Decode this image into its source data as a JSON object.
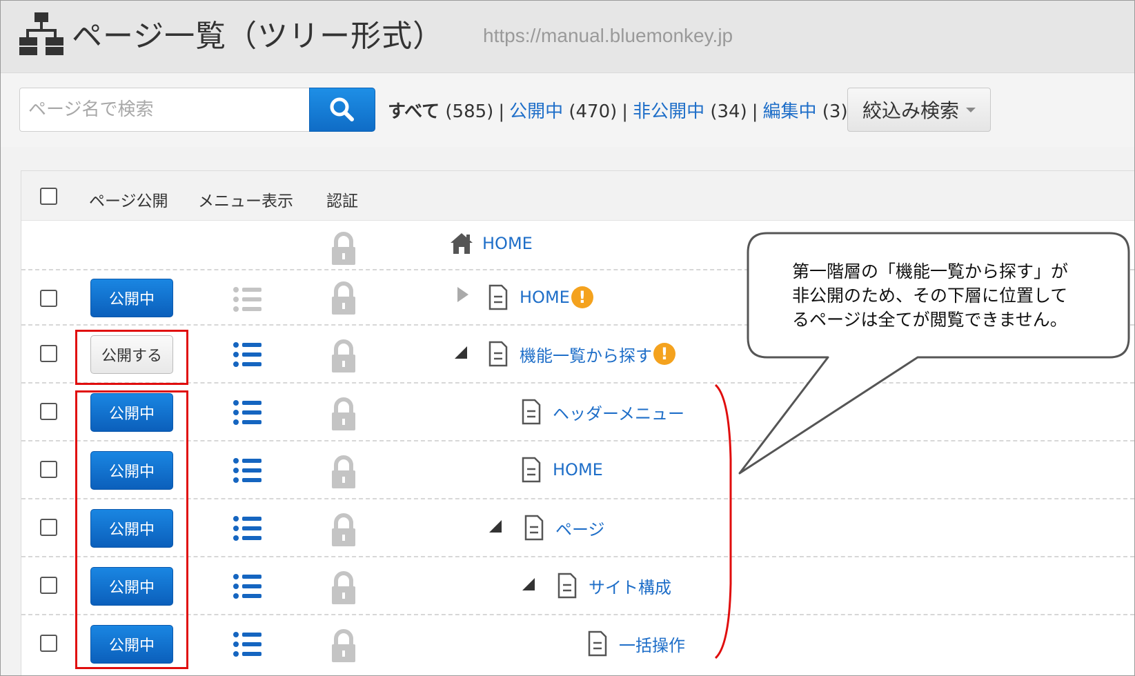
{
  "header": {
    "title": "ページ一覧（ツリー形式）",
    "url": "https://manual.bluemonkey.jp"
  },
  "search": {
    "placeholder": "ページ名で検索"
  },
  "filters": {
    "all_label": "すべて",
    "all_count": "(585)",
    "public_label": "公開中",
    "public_count": "(470)",
    "private_label": "非公開中",
    "private_count": "(34)",
    "editing_label": "編集中",
    "editing_count": "(3)",
    "separator": "|",
    "refine_label": "絞込み検索"
  },
  "table": {
    "columns": [
      "ページ公開",
      "メニュー表示",
      "認証"
    ],
    "root_label": "HOME",
    "rows": [
      {
        "button": "公開中",
        "page": "HOME"
      },
      {
        "button": "公開する",
        "page": "機能一覧から探す"
      },
      {
        "button": "公開中",
        "page": "ヘッダーメニュー"
      },
      {
        "button": "公開中",
        "page": "HOME"
      },
      {
        "button": "公開中",
        "page": "ページ"
      },
      {
        "button": "公開中",
        "page": "サイト構成"
      },
      {
        "button": "公開中",
        "page": "一括操作"
      }
    ]
  },
  "callout": {
    "line1": "第一階層の「機能一覧から探す」が",
    "line2": "非公開のため、その下層に位置して",
    "line3": "るページは全てが閲覧できません。"
  },
  "colors": {
    "accent": "#1e6ec8",
    "button_blue": "#0f6cc6",
    "warning": "#f4a21e",
    "annotation_red": "#e00d0d"
  },
  "icons": {
    "sitemap": "sitemap-icon",
    "search": "search-icon",
    "menu": "list-icon",
    "lock": "lock-icon",
    "home": "home-icon",
    "document": "document-icon",
    "warning": "exclamation-icon"
  }
}
